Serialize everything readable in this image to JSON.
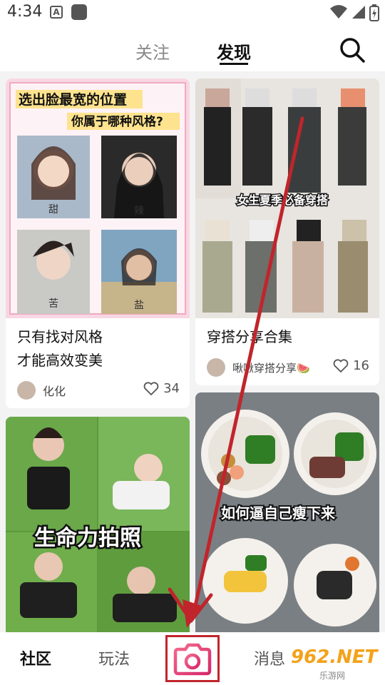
{
  "status_bar": {
    "time": "4:34",
    "notif_letter": "A"
  },
  "top_nav": {
    "tab_follow": "关注",
    "tab_discover": "发现"
  },
  "feed": {
    "cards": [
      {
        "cover_headline": "选出脸最宽的位置",
        "cover_subheadline": "你属于哪种风格?",
        "cover_tags": [
          "甜",
          "辣",
          "苦",
          "盐"
        ],
        "title_line1": "只有找对风格",
        "title_line2": "才能高效变美",
        "author": "化化",
        "likes": "34"
      },
      {
        "cover_caption": "女生夏季必备穿搭",
        "title_line1": "穿搭分享合集",
        "author": "啾啾穿搭分享🍉",
        "likes": "16"
      },
      {
        "cover_caption": "生命力拍照"
      },
      {
        "cover_caption": "如何逼自己瘦下来"
      }
    ]
  },
  "bottom_nav": {
    "community": "社区",
    "play": "玩法",
    "messages": "消息",
    "watermark": "962.NET",
    "watermark_sub": "乐游网"
  },
  "colors": {
    "annotation_red": "#c0252b",
    "camera_pink": "#e8437a"
  }
}
